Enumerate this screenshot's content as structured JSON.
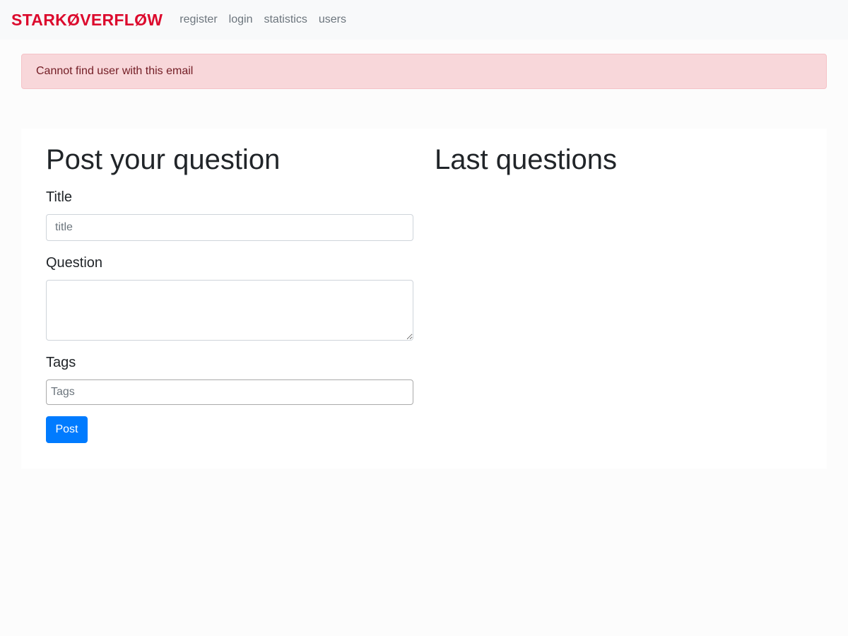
{
  "navbar": {
    "brand": "STARKØVERFLØW",
    "links": [
      "register",
      "login",
      "statistics",
      "users"
    ]
  },
  "alert": {
    "message": "Cannot find user with this email"
  },
  "form": {
    "heading": "Post your question",
    "title_label": "Title",
    "title_placeholder": "title",
    "question_label": "Question",
    "tags_label": "Tags",
    "tags_placeholder": "Tags",
    "post_button": "Post"
  },
  "sidebar": {
    "heading": "Last questions"
  },
  "colors": {
    "brand": "#dc0a2d",
    "alert_bg": "#f8d7da",
    "alert_text": "#721c24",
    "primary": "#007bff"
  }
}
